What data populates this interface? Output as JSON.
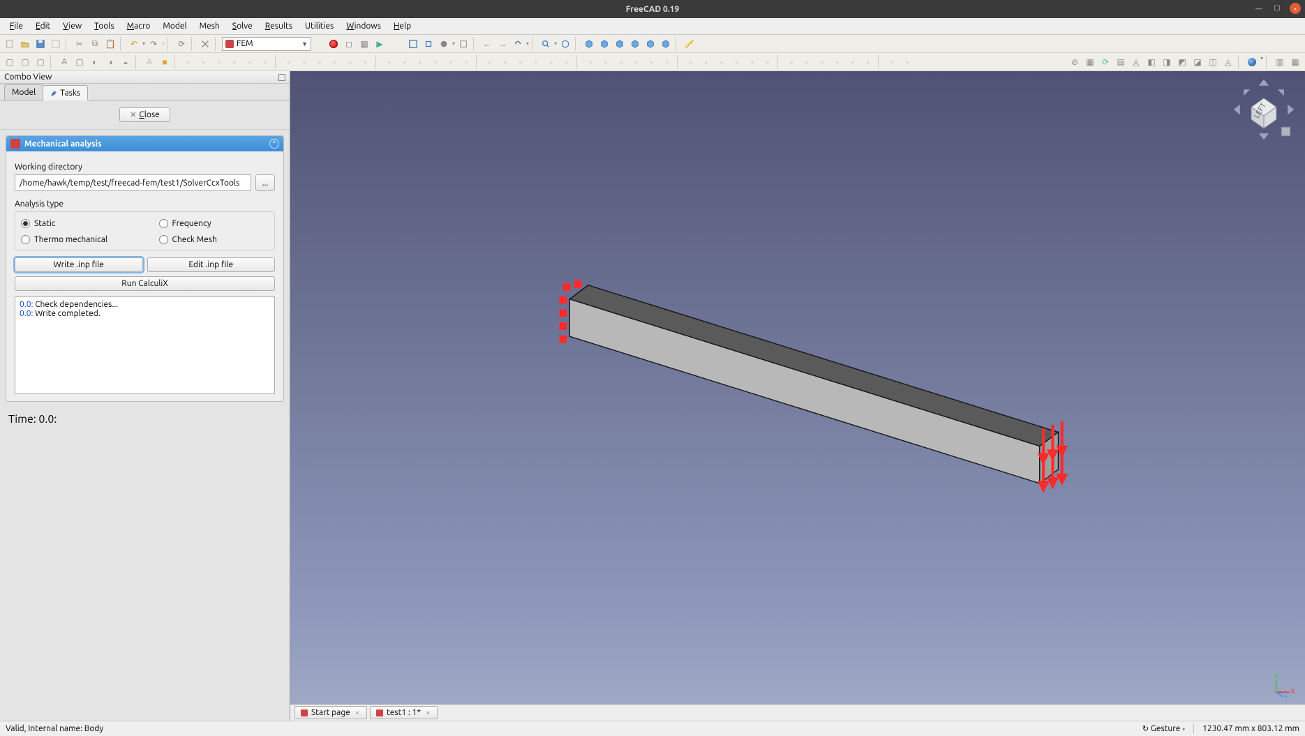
{
  "window": {
    "title": "FreeCAD 0.19"
  },
  "menu": {
    "file": {
      "label": "File",
      "underline": "F"
    },
    "edit": {
      "label": "Edit",
      "underline": "E"
    },
    "view": {
      "label": "View",
      "underline": "V"
    },
    "tools": {
      "label": "Tools",
      "underline": "T"
    },
    "macro": {
      "label": "Macro",
      "underline": "M"
    },
    "model": {
      "label": "Model",
      "underline": "M"
    },
    "mesh": {
      "label": "Mesh",
      "underline": ""
    },
    "solve": {
      "label": "Solve",
      "underline": "S"
    },
    "results": {
      "label": "Results",
      "underline": "R"
    },
    "utils": {
      "label": "Utilities",
      "underline": ""
    },
    "windows": {
      "label": "Windows",
      "underline": "W"
    },
    "help": {
      "label": "Help",
      "underline": "H"
    }
  },
  "workbench": {
    "label": "FEM"
  },
  "combo": {
    "header": "Combo View",
    "tab_model": "Model",
    "tab_tasks": "Tasks"
  },
  "close_btn": {
    "label": "Close"
  },
  "task": {
    "title": "Mechanical analysis",
    "wd_label": "Working directory",
    "wd_value": "/home/hawk/temp/test/freecad-fem/test1/SolverCcxTools",
    "browse": "...",
    "atype_label": "Analysis type",
    "opt_static": "Static",
    "opt_frequency": "Frequency",
    "opt_thermo": "Thermo mechanical",
    "opt_checkmesh": "Check Mesh",
    "btn_write": "Write .inp file",
    "btn_edit": "Edit .inp file",
    "btn_run": "Run CalculiX",
    "log": [
      {
        "t": "0.0:",
        "msg": " Check dependencies..."
      },
      {
        "t": "0.0:",
        "msg": " Write completed."
      }
    ],
    "time_label": "Time:  0.0:"
  },
  "viewport_tabs": {
    "start": "Start page",
    "test1": "test1 : 1*"
  },
  "status": {
    "left": "Valid, Internal name: Body",
    "nav": "Gesture",
    "dims": "1230.47 mm x 803.12 mm"
  },
  "navcube": {
    "face": "LEFT"
  }
}
